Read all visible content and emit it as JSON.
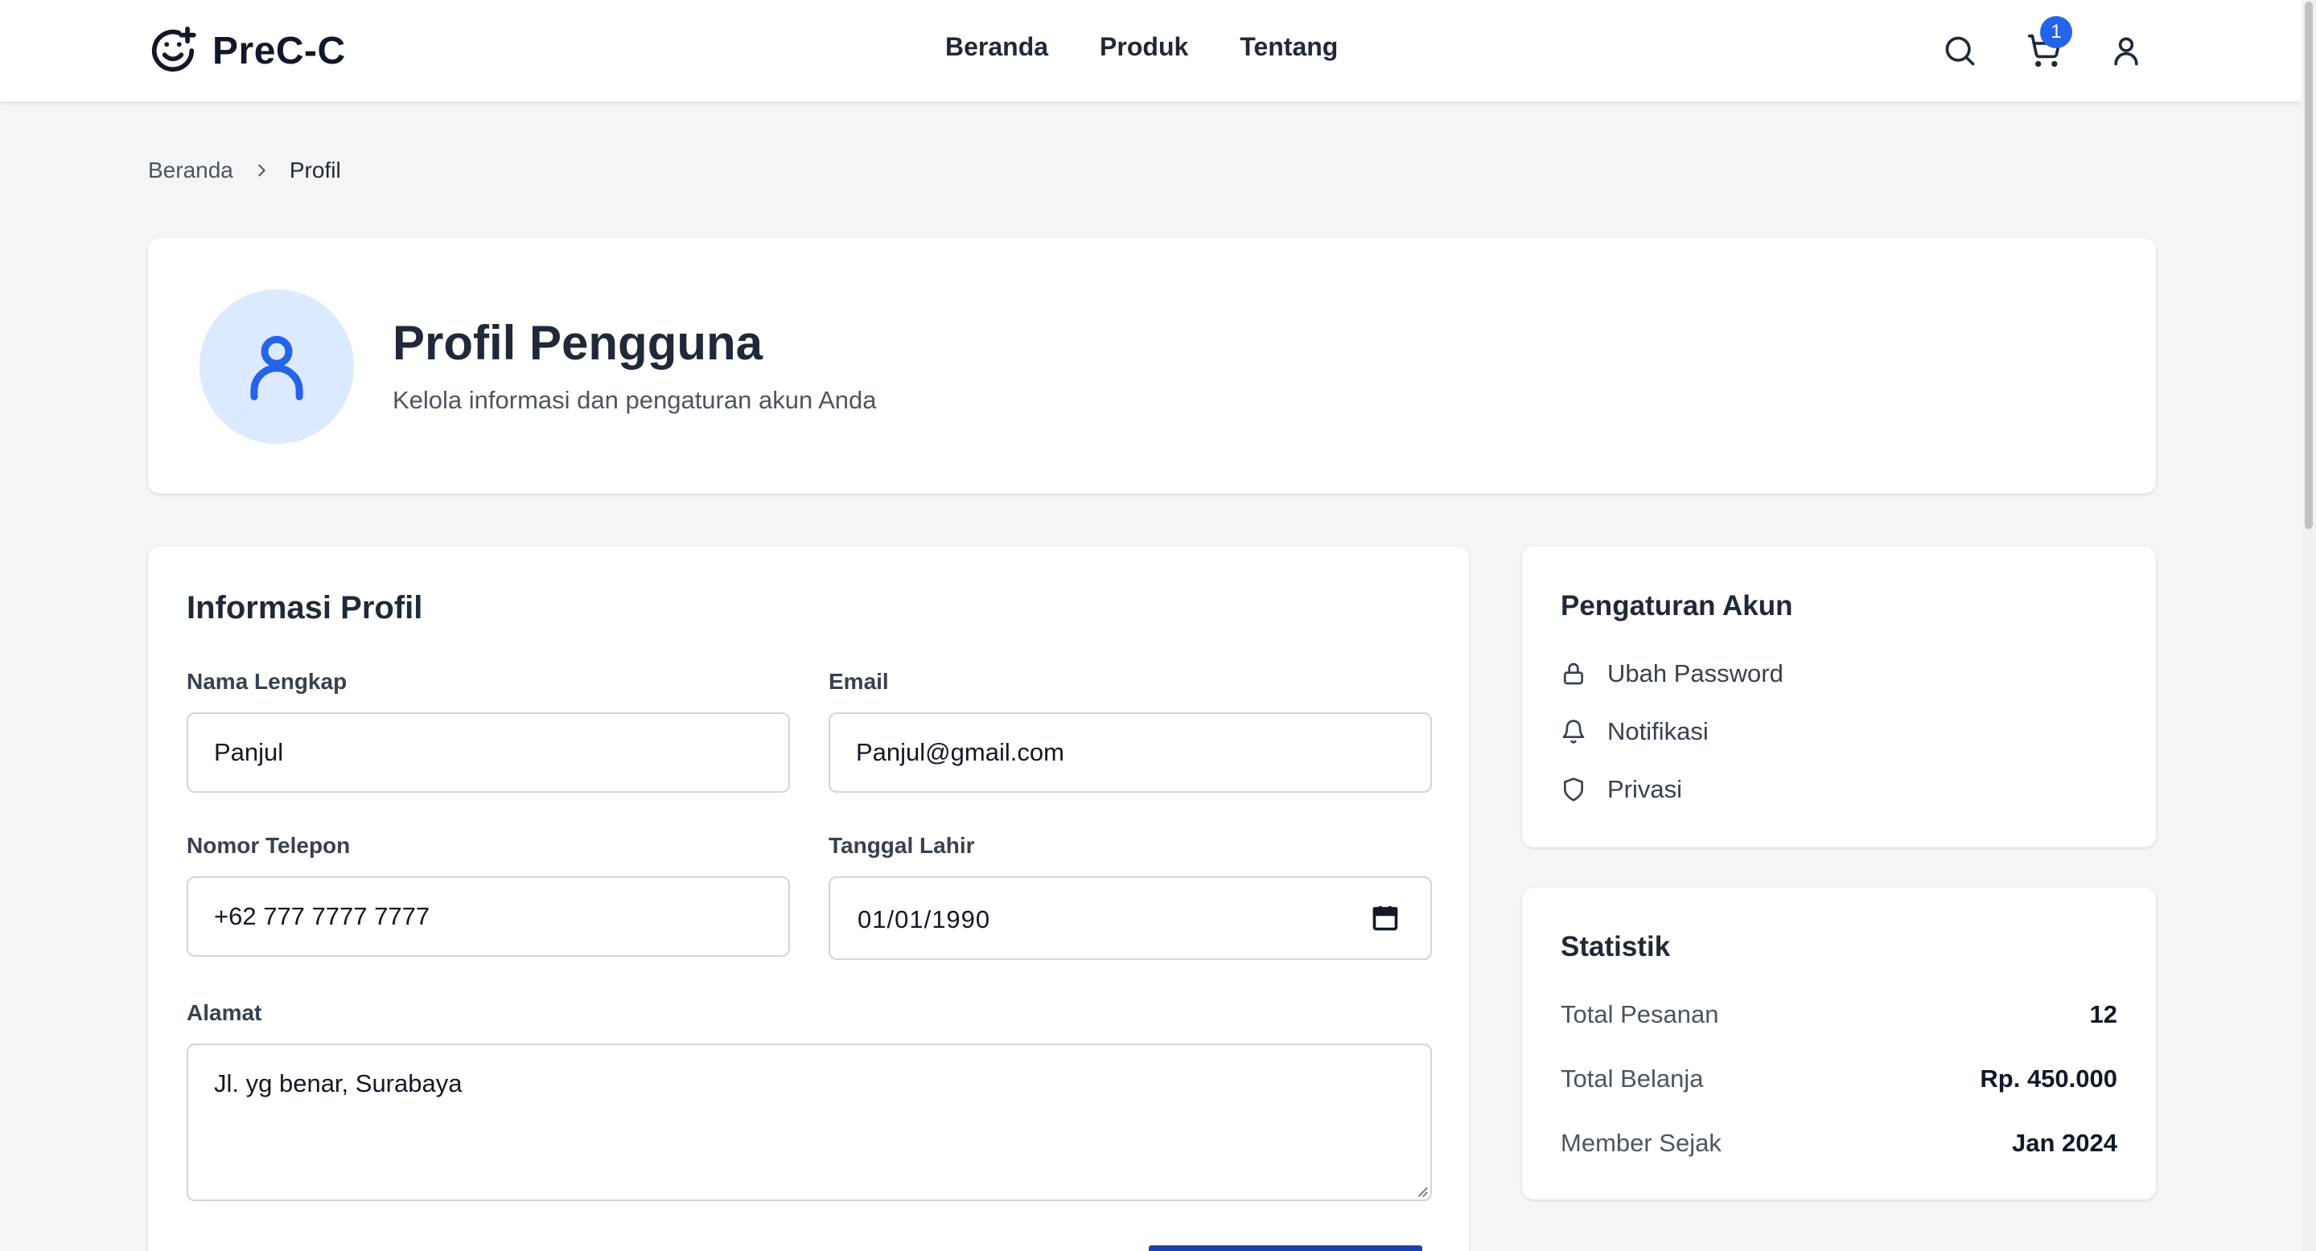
{
  "brand": {
    "name": "PreC-C",
    "logo_icon": "smiley-plus-icon"
  },
  "nav": {
    "items": [
      "Beranda",
      "Produk",
      "Tentang"
    ]
  },
  "header_icons": {
    "search": "search-icon",
    "cart": "cart-icon",
    "cart_count": "1",
    "user": "user-icon"
  },
  "breadcrumb": {
    "home": "Beranda",
    "current": "Profil"
  },
  "hero": {
    "title": "Profil Pengguna",
    "subtitle": "Kelola informasi dan pengaturan akun Anda",
    "avatar_icon": "user-icon"
  },
  "profile_form": {
    "title": "Informasi Profil",
    "name_label": "Nama Lengkap",
    "name_value": "Panjul",
    "email_label": "Email",
    "email_value": "Panjul@gmail.com",
    "phone_label": "Nomor Telepon",
    "phone_value": "+62 777 7777 7777",
    "birth_label": "Tanggal Lahir",
    "birth_value": "01/01/1990",
    "address_label": "Alamat",
    "address_value": "Jl. yg benar, Surabaya"
  },
  "account_settings": {
    "title": "Pengaturan Akun",
    "items": [
      {
        "label": "Ubah Password",
        "icon": "lock-icon"
      },
      {
        "label": "Notifikasi",
        "icon": "bell-icon"
      },
      {
        "label": "Privasi",
        "icon": "shield-icon"
      }
    ]
  },
  "stats": {
    "title": "Statistik",
    "rows": [
      {
        "label": "Total Pesanan",
        "value": "12"
      },
      {
        "label": "Total Belanja",
        "value": "Rp. 450.000"
      },
      {
        "label": "Member Sejak",
        "value": "Jan 2024"
      }
    ]
  },
  "colors": {
    "accent": "#2563eb",
    "avatar_bg": "#dbeafe",
    "page_bg": "#f4f5f7"
  }
}
